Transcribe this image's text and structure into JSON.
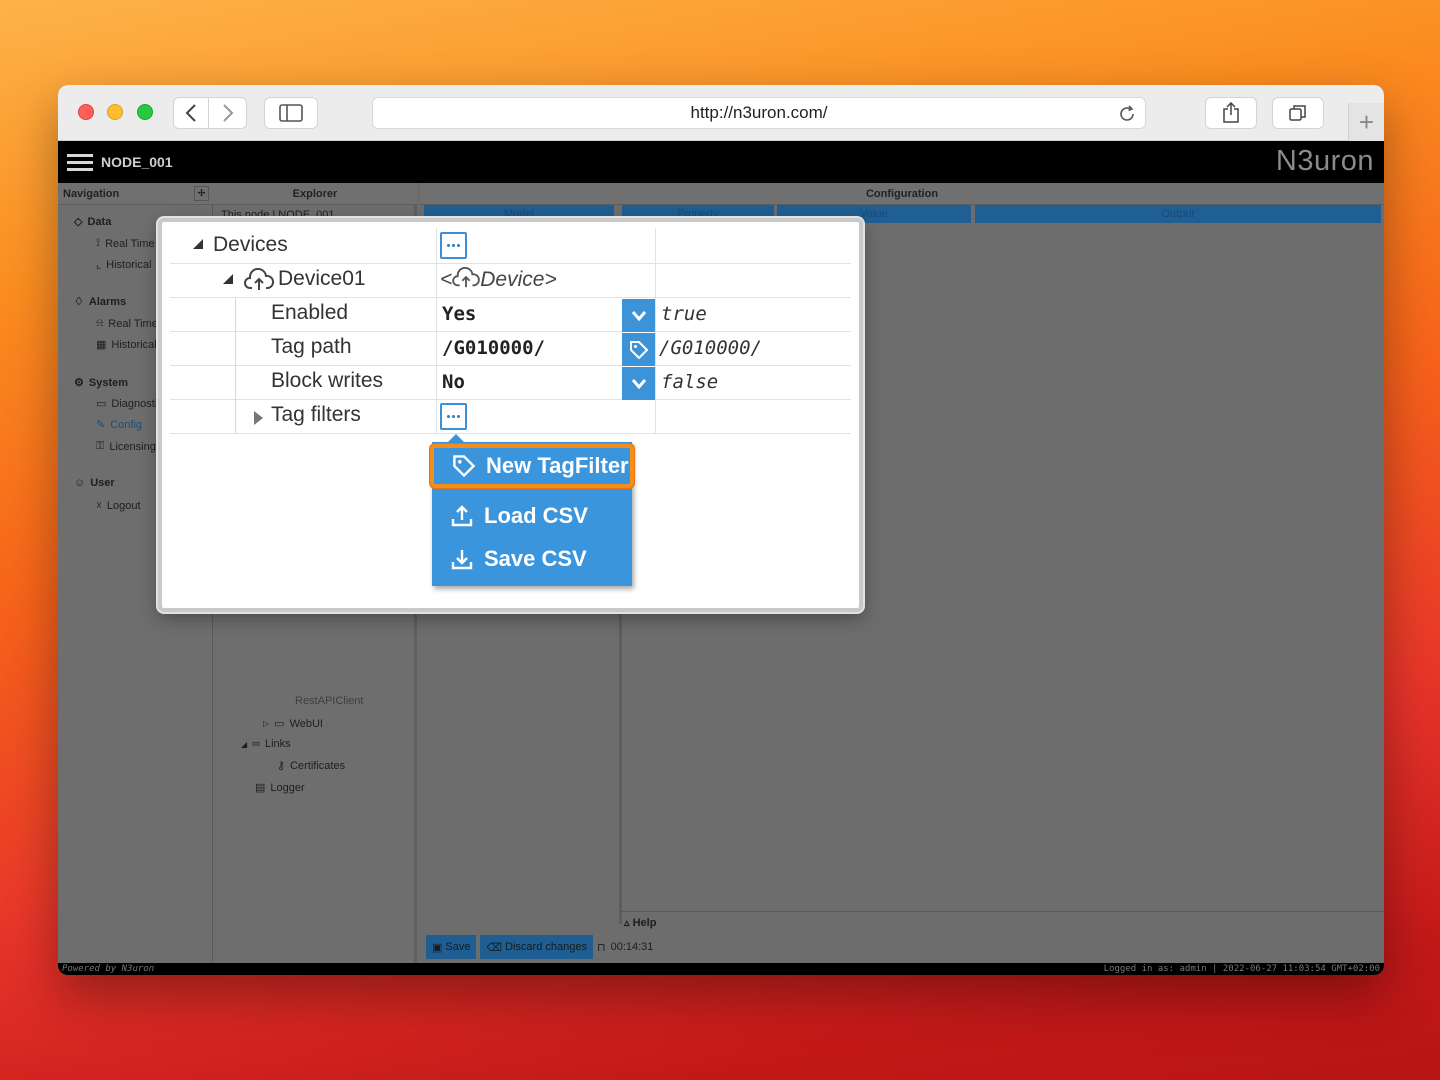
{
  "browser": {
    "url": "http://n3uron.com/"
  },
  "app": {
    "node_name": "NODE_001",
    "brand": "N3uron"
  },
  "navigation": {
    "title": "Navigation",
    "sections": [
      {
        "label": "Data",
        "items": [
          "Real Time",
          "Historical"
        ]
      },
      {
        "label": "Alarms",
        "items": [
          "Real Time",
          "Historical"
        ]
      },
      {
        "label": "System",
        "items": [
          "Diagnostic",
          "Config",
          "Licensing"
        ]
      },
      {
        "label": "User",
        "items": [
          "Logout"
        ]
      }
    ]
  },
  "explorer": {
    "title": "Explorer",
    "top_item": "This node | NODE_001",
    "partial_item": "RestAPIClient",
    "items": [
      "WebUI",
      "Links",
      "Certificates",
      "Logger"
    ]
  },
  "configuration": {
    "title": "Configuration",
    "columns": [
      "Model",
      "Property",
      "Value",
      "Output"
    ],
    "help_label": "Help",
    "save_label": "Save",
    "discard_label": "Discard changes",
    "timer": "00:14:31"
  },
  "statusbar": {
    "left": "Powered by N3uron",
    "right": "Logged in as: admin | 2022-06-27 11:03:54 GMT+02:00"
  },
  "zoom": {
    "devices_label": "Devices",
    "device_name": "Device01",
    "device_type": "<Device>",
    "properties": [
      {
        "name": "Enabled",
        "value": "Yes",
        "output": "true",
        "button_icon": "chevron-down-icon"
      },
      {
        "name": "Tag path",
        "value": "/G010000/",
        "output": "/G010000/",
        "button_icon": "tag-icon"
      },
      {
        "name": "Block writes",
        "value": "No",
        "output": "false",
        "button_icon": "chevron-down-icon"
      }
    ],
    "tag_filters_label": "Tag filters",
    "menu": [
      {
        "label": "New TagFilter",
        "icon": "tag-icon",
        "highlighted": true
      },
      {
        "label": "Load CSV",
        "icon": "upload-icon",
        "highlighted": false
      },
      {
        "label": "Save CSV",
        "icon": "download-icon",
        "highlighted": false
      }
    ],
    "highlight_color": "#f58d1a",
    "accent_color": "#3b95dc"
  }
}
